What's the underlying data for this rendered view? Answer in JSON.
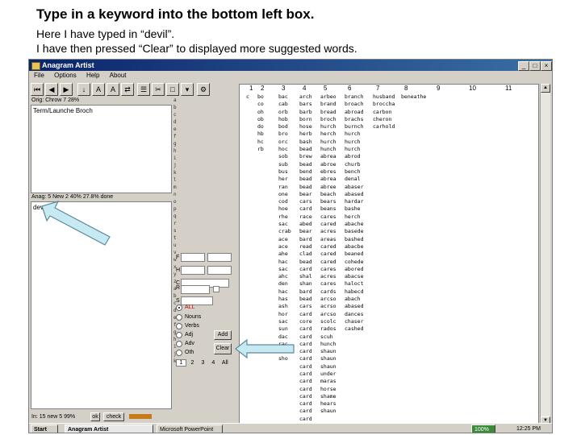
{
  "caption": {
    "title": "Type in a keyword into the bottom left box.",
    "line1": "Here I have typed in “devil”.",
    "line2": "I have then pressed “Clear” to displayed more suggested words."
  },
  "window": {
    "title": "Anagram Artist"
  },
  "menu": [
    "File",
    "Options",
    "Help",
    "About"
  ],
  "top_pane": {
    "status": "Orig:  Chrow 7  28%",
    "text": "Term/Launche Broch"
  },
  "bottom_pane": {
    "status": "Anag: 5  New 2  40%      27.8% done",
    "text": "dev"
  },
  "filters": {
    "options": [
      "ALL",
      "Nouns",
      "Verbs",
      "Adj",
      "Adv",
      "Oth"
    ],
    "selected": "ALL",
    "add_button": "Add",
    "clear_button": "Clear",
    "tabs": [
      "1",
      "2",
      "3",
      "4",
      "All"
    ]
  },
  "grid": {
    "headers": [
      "1",
      "2",
      "3",
      "4",
      "5",
      "6",
      "7",
      "8",
      "9",
      "10",
      "11"
    ],
    "columns": [
      {
        "words": [
          "c"
        ]
      },
      {
        "words": [
          "bo",
          "co",
          "oh",
          "ob",
          "do",
          "hb",
          "hc",
          "rb"
        ]
      },
      {
        "words": [
          "bac",
          "cab",
          "orb",
          "hob",
          "bod",
          "bro",
          "orc",
          "hoc",
          "sob",
          "sub",
          "bus",
          "her",
          "ran",
          "one",
          "cod",
          "hoe",
          "rhe",
          "sac",
          "crab",
          "ace",
          "ace",
          "ahe",
          "hac",
          "sac",
          "ahc",
          "den",
          "hac",
          "has",
          "ash",
          "hor",
          "sac",
          "sun",
          "dac",
          "rac",
          "shac",
          "sho"
        ]
      },
      {
        "words": [
          "arch",
          "bars",
          "barb",
          "born",
          "hose",
          "herb",
          "bash",
          "bead",
          "brew",
          "bead",
          "bend",
          "bead",
          "bead",
          "bear",
          "cars",
          "card",
          "race",
          "abed",
          "bear",
          "bard",
          "read",
          "clad",
          "bead",
          "card",
          "shal",
          "shan",
          "bard",
          "bead",
          "cars",
          "card",
          "core",
          "card",
          "card",
          "card",
          "card",
          "card",
          "card",
          "card",
          "card",
          "card",
          "card",
          "card",
          "card",
          "card",
          "card",
          "card",
          "card",
          "card"
        ]
      },
      {
        "words": [
          "arbeo",
          "brand",
          "bread",
          "broch",
          "hurch",
          "herch",
          "hurch",
          "hunch",
          "abrea",
          "abroe",
          "ebres",
          "abrea",
          "abree",
          "beach",
          "bears",
          "beans",
          "cares",
          "cared",
          "acres",
          "areas",
          "cared",
          "cared",
          "cared",
          "cares",
          "acres",
          "cares",
          "cards",
          "arcso",
          "acrso",
          "arcso",
          "scolc",
          "rados",
          "scuh",
          "hunch",
          "shaun",
          "shaun",
          "shaun",
          "under",
          "maras",
          "horse",
          "shame",
          "hears",
          "shaun"
        ]
      },
      {
        "words": [
          "branch",
          "broach",
          "abroad",
          "brachs",
          "burnch",
          "hurch",
          "hurch",
          "hurch",
          "abrod",
          "churb",
          "bench",
          "denal",
          "abaser",
          "abased",
          "hardar",
          "bashe",
          "herch",
          "abache",
          "basede",
          "bashed",
          "abacbe",
          "beaned",
          "cohede",
          "abored",
          "abacse",
          "haloct",
          "habecd",
          "abach",
          "abased",
          "dances",
          "chaser",
          "cashed"
        ]
      },
      {
        "words": [
          "husband",
          "broccha",
          "carbon",
          "cheron",
          "carhold"
        ]
      },
      {
        "words": [
          "beneathe"
        ]
      },
      {
        "words": []
      },
      {
        "words": []
      },
      {
        "words": []
      }
    ]
  },
  "status_bar": {
    "left": "In: 15  new 5 99%",
    "ok": "ok",
    "check": "check"
  },
  "taskbar": {
    "start": "Start",
    "tasks": [
      "Anagram Artist",
      "Microsoft PowerPoint"
    ],
    "badge": "100%",
    "clock": "12:25 PM"
  }
}
